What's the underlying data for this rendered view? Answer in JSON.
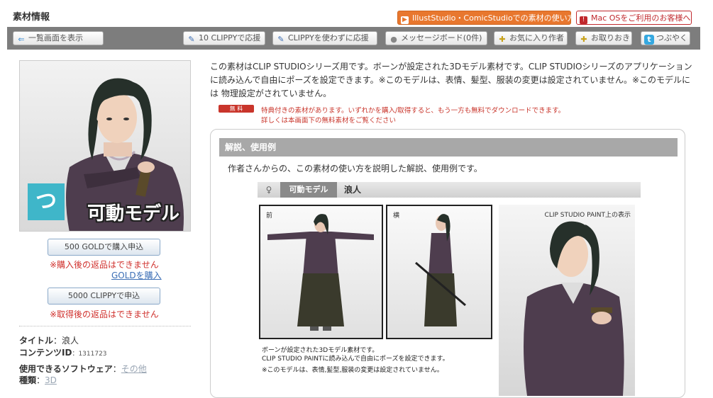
{
  "header": {
    "title": "素材情報",
    "orange_link": "IllustStudio・ComicStudioでの素材の使い方",
    "mac_link": "Mac OSをご利用のお客様へ",
    "orange_color": "#e8772e",
    "mac_color": "#c0282d"
  },
  "toolbar": {
    "back": "一覧画面を表示",
    "clippy10": "10 CLIPPYで応援",
    "clippy_free": "CLIPPYを使わずに応援",
    "message": "メッセージボード(0件)",
    "favorite": "お気に入り作者",
    "keep": "お取りおき",
    "tweet": "つぶやく"
  },
  "left": {
    "thumb_label": "可動モデル",
    "buy_gold": "500 GOLDで購入申込",
    "no_return_buy": "※購入後の返品はできません",
    "gold_link": "GOLDを購入",
    "buy_clippy": "5000 CLIPPYで申込",
    "no_return_get": "※取得後の返品はできません",
    "title_label": "タイトル",
    "title_value": "浪人",
    "content_id_label": "コンテンツID",
    "content_id_value": "1311723",
    "software_label": "使用できるソフトウェア",
    "software_value": "その他",
    "type_label": "種類",
    "type_value": "3D"
  },
  "description": {
    "text": "この素材はCLIP STUDIOシリーズ用です。ボーンが設定された3Dモデル素材です。CLIP STUDIOシリーズのアプリケーションに読み込んで自由にポーズを設定できます。※このモデルは、表情、髪型、服装の変更は設定されていません。※このモデルには 物理設定がされていません。",
    "free_badge": "無 料",
    "free_note_1": "特典付きの素材があります。いずれかを購入/取得すると、もう一方も無料でダウンロードできます。",
    "free_note_2": "詳しくは本画面下の無料素材をご覧ください"
  },
  "panel": {
    "heading": "解説、使用例",
    "intro": "作者さんからの、この素材の使い方を説明した解説、使用例です。",
    "model_tag": "可動モデル",
    "model_name": "浪人",
    "front_label": "前",
    "side_label": "横",
    "paint_label": "CLIP STUDIO PAINT上の表示",
    "caption_1": "ボーンが設定された3Dモデル素材です。",
    "caption_2": "CLIP STUDIO PAINTに読み込んで自由にポーズを設定できます。",
    "caption_3": "※このモデルは、表情,髪型,服装の変更は設定されていません。"
  }
}
